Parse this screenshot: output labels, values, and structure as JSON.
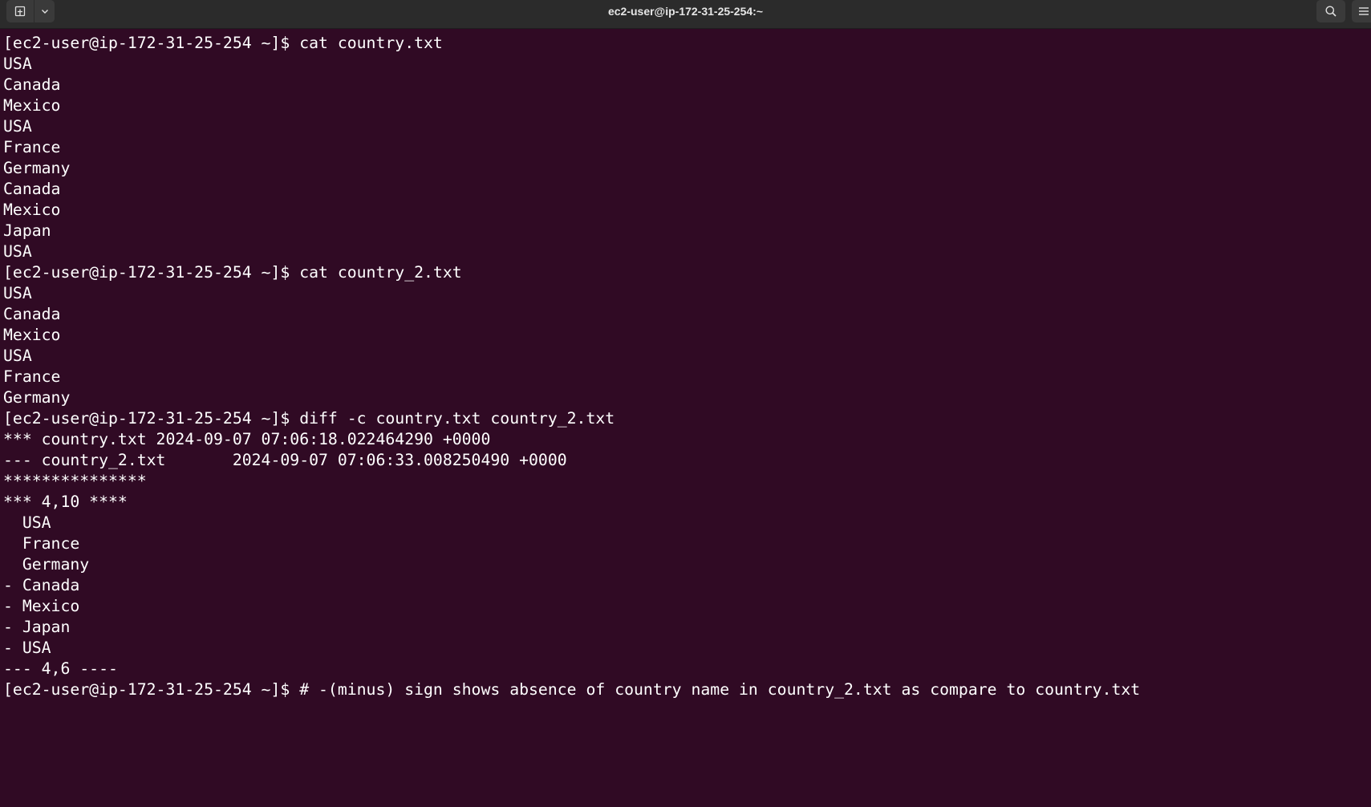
{
  "window": {
    "title": "ec2-user@ip-172-31-25-254:~"
  },
  "icons": {
    "new_tab": "new-tab-icon",
    "tab_menu": "chevron-down-icon",
    "search": "search-icon",
    "menu": "hamburger-menu-icon"
  },
  "colors": {
    "terminal_bg": "#300a24",
    "titlebar_bg": "#2b2b2b",
    "text": "#ffffff"
  },
  "terminal": {
    "lines": [
      "[ec2-user@ip-172-31-25-254 ~]$ cat country.txt",
      "USA",
      "Canada",
      "Mexico",
      "USA",
      "France",
      "Germany",
      "Canada",
      "Mexico",
      "Japan",
      "USA",
      "[ec2-user@ip-172-31-25-254 ~]$ cat country_2.txt",
      "USA",
      "Canada",
      "Mexico",
      "USA",
      "France",
      "Germany",
      "[ec2-user@ip-172-31-25-254 ~]$ diff -c country.txt country_2.txt",
      "*** country.txt 2024-09-07 07:06:18.022464290 +0000",
      "--- country_2.txt       2024-09-07 07:06:33.008250490 +0000",
      "***************",
      "*** 4,10 ****",
      "  USA",
      "  France",
      "  Germany",
      "- Canada",
      "- Mexico",
      "- Japan",
      "- USA",
      "--- 4,6 ----",
      "[ec2-user@ip-172-31-25-254 ~]$ # -(minus) sign shows absence of country name in country_2.txt as compare to country.txt"
    ]
  }
}
